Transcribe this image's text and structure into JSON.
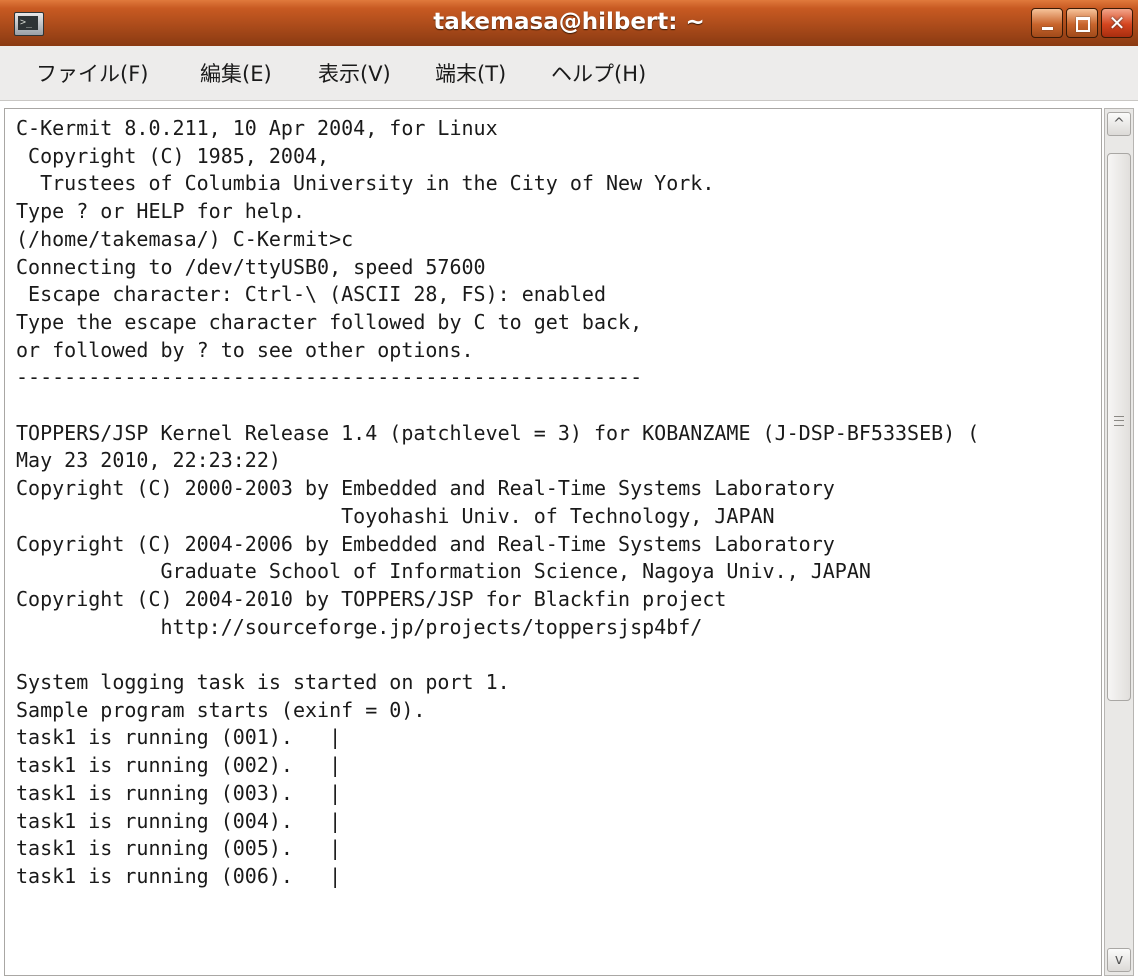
{
  "window": {
    "title": "takemasa@hilbert: ~",
    "app_icon": "terminal-icon",
    "controls": {
      "minimize_icon": "minimize-icon",
      "maximize_icon": "maximize-icon",
      "close_glyph": "✕"
    }
  },
  "menu": {
    "items": [
      "ファイル(F)",
      "編集(E)",
      "表示(V)",
      "端末(T)",
      "ヘルプ(H)"
    ]
  },
  "terminal": {
    "lines": [
      "C-Kermit 8.0.211, 10 Apr 2004, for Linux",
      " Copyright (C) 1985, 2004,",
      "  Trustees of Columbia University in the City of New York.",
      "Type ? or HELP for help.",
      "(/home/takemasa/) C-Kermit>c",
      "Connecting to /dev/ttyUSB0, speed 57600",
      " Escape character: Ctrl-\\ (ASCII 28, FS): enabled",
      "Type the escape character followed by C to get back,",
      "or followed by ? to see other options.",
      "----------------------------------------------------",
      "",
      "TOPPERS/JSP Kernel Release 1.4 (patchlevel = 3) for KOBANZAME (J-DSP-BF533SEB) (",
      "May 23 2010, 22:23:22)",
      "Copyright (C) 2000-2003 by Embedded and Real-Time Systems Laboratory",
      "                           Toyohashi Univ. of Technology, JAPAN",
      "Copyright (C) 2004-2006 by Embedded and Real-Time Systems Laboratory",
      "            Graduate School of Information Science, Nagoya Univ., JAPAN",
      "Copyright (C) 2004-2010 by TOPPERS/JSP for Blackfin project",
      "            http://sourceforge.jp/projects/toppersjsp4bf/",
      "",
      "System logging task is started on port 1.",
      "Sample program starts (exinf = 0).",
      "task1 is running (001).   |",
      "task1 is running (002).   |",
      "task1 is running (003).   |",
      "task1 is running (004).   |",
      "task1 is running (005).   |",
      "task1 is running (006).   |"
    ]
  },
  "scrollbar": {
    "up_arrow": "^",
    "down_arrow": "v",
    "position": 0.66
  },
  "colors": {
    "titlebar": "#c85a22",
    "menubar": "#edeceb",
    "terminal_bg": "#ffffff",
    "terminal_fg": "#1a1a1a"
  }
}
